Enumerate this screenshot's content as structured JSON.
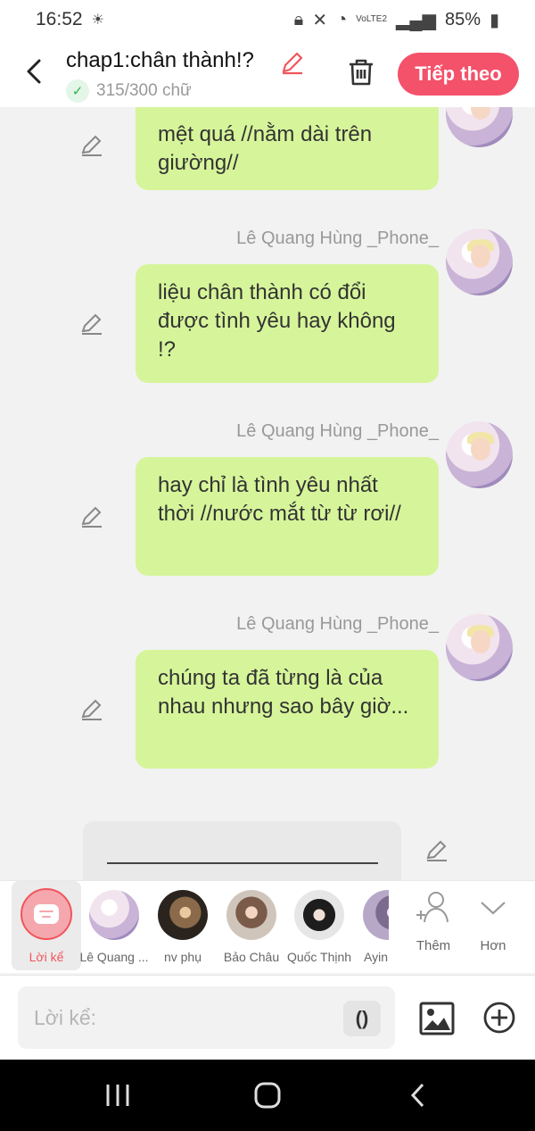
{
  "status_bar": {
    "time": "16:52",
    "network": "VoLTE2",
    "battery": "85%"
  },
  "header": {
    "title": "chap1:chân thành!?",
    "word_count": "315/300 chữ",
    "next_label": "Tiếp theo"
  },
  "messages": [
    {
      "sender": "",
      "text": "mệt quá //nằm dài trên giường//"
    },
    {
      "sender": "Lê Quang Hùng _Phone_",
      "text": "liệu chân thành có đổi được tình yêu hay không !?"
    },
    {
      "sender": "Lê Quang Hùng _Phone_",
      "text": "hay chỉ là tình yêu nhất thời //nước mắt từ từ rơi//"
    },
    {
      "sender": "Lê Quang Hùng _Phone_",
      "text": "chúng ta đã từng là của nhau nhưng sao bây giờ..."
    }
  ],
  "characters": [
    {
      "label": "Lời kể",
      "icon": "narrator-icon",
      "selected": true
    },
    {
      "label": "Lê Quang ...",
      "icon": "avatar"
    },
    {
      "label": "nv phụ",
      "icon": "avatar"
    },
    {
      "label": "Bảo Châu",
      "icon": "avatar"
    },
    {
      "label": "Quốc Thịnh",
      "icon": "avatar"
    },
    {
      "label": "Ayin",
      "icon": "avatar"
    }
  ],
  "actions": {
    "add_label": "Thêm",
    "more_label": "Hơn"
  },
  "composer": {
    "placeholder": "Lời kể:",
    "paren_label": "()"
  },
  "colors": {
    "accent": "#f4516b",
    "bubble": "#d6f59a"
  }
}
